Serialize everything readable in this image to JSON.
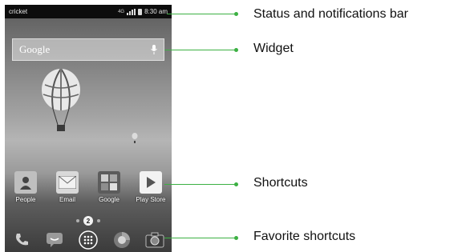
{
  "status_bar": {
    "carrier": "cricket",
    "network": "4G",
    "time": "8:30 am"
  },
  "search_widget": {
    "brand": "Google"
  },
  "shortcuts": [
    {
      "label": "People",
      "icon": "people-icon"
    },
    {
      "label": "Email",
      "icon": "email-icon"
    },
    {
      "label": "Google",
      "icon": "google-folder-icon"
    },
    {
      "label": "Play Store",
      "icon": "play-store-icon"
    }
  ],
  "page_indicator": {
    "current_page": "2"
  },
  "favorites": [
    {
      "icon": "phone-icon"
    },
    {
      "icon": "messaging-icon"
    },
    {
      "icon": "app-drawer-icon"
    },
    {
      "icon": "browser-icon"
    },
    {
      "icon": "camera-icon"
    }
  ],
  "callouts": {
    "status_bar": "Status and notifications bar",
    "widget": "Widget",
    "shortcuts": "Shortcuts",
    "favorite_shortcuts": "Favorite shortcuts"
  },
  "colors": {
    "callout_line": "#3cb043",
    "status_bar_bg": "#0d0d0d"
  }
}
